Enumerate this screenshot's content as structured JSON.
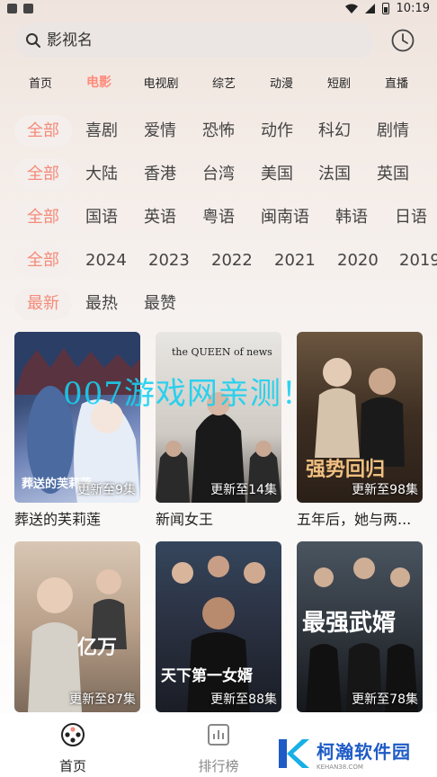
{
  "status": {
    "time": "10:19"
  },
  "search": {
    "placeholder": "影视名"
  },
  "tabs": [
    "首页",
    "电影",
    "电视剧",
    "综艺",
    "动漫",
    "短剧",
    "直播"
  ],
  "filters": {
    "genre": [
      "全部",
      "喜剧",
      "爱情",
      "恐怖",
      "动作",
      "科幻",
      "剧情"
    ],
    "region": [
      "全部",
      "大陆",
      "香港",
      "台湾",
      "美国",
      "法国",
      "英国"
    ],
    "language": [
      "全部",
      "国语",
      "英语",
      "粤语",
      "闽南语",
      "韩语",
      "日语"
    ],
    "year": [
      "全部",
      "2024",
      "2023",
      "2022",
      "2021",
      "2020",
      "2019"
    ],
    "sort": [
      "最新",
      "最热",
      "最赞"
    ]
  },
  "cards": [
    {
      "title": "葬送的芙莉莲",
      "badge": "更新至9集",
      "poster_text": "葬送的芙莉莲"
    },
    {
      "title": "新闻女王",
      "badge": "更新至14集",
      "poster_text": "the QUEEN of news"
    },
    {
      "title": "五年后，她与两...",
      "badge": "更新至98集",
      "poster_text": "强势回归"
    },
    {
      "title": "",
      "badge": "更新至87集",
      "poster_text": "亿万"
    },
    {
      "title": "",
      "badge": "更新至88集",
      "poster_text": "天下第一女婿"
    },
    {
      "title": "",
      "badge": "更新至78集",
      "poster_text": "最强武婿"
    }
  ],
  "watermark": "007游戏网亲测！",
  "nav": [
    "首页",
    "排行榜"
  ],
  "brand": {
    "name": "柯瀚软件园",
    "url": "KEHAN38.COM"
  },
  "colors": {
    "accent": "#ff8a7a",
    "selected_chip_bg": "#f4efec",
    "brand": "#1e5bc6",
    "watermark": "#19d0f0"
  }
}
